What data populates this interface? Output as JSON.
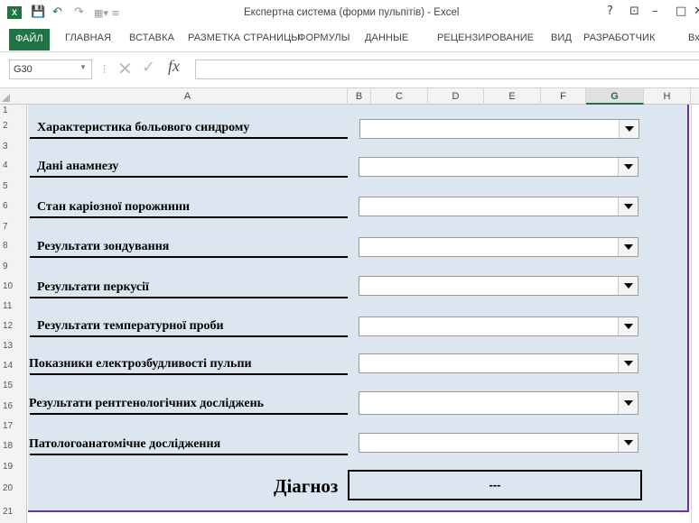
{
  "window": {
    "title": "Експертна система (форми пульпітів) - Excel",
    "help": "?",
    "ribbon_display": "⊡",
    "minimize": "–",
    "close": "✕"
  },
  "ribbon": {
    "tabs": [
      "ФАЙЛ",
      "ГЛАВНАЯ",
      "ВСТАВКА",
      "РАЗМЕТКА СТРАНИЦЫ",
      "ФОРМУЛЫ",
      "ДАННЫЕ",
      "РЕЦЕНЗИРОВАНИЕ",
      "ВИД",
      "РАЗРАБОТЧИК",
      "Вх"
    ]
  },
  "formula_bar": {
    "name_box": "G30",
    "fx": "fx",
    "value": ""
  },
  "columns": [
    "A",
    "B",
    "C",
    "D",
    "E",
    "F",
    "G",
    "H"
  ],
  "active_column": "G",
  "rows": [
    "1",
    "2",
    "3",
    "4",
    "5",
    "6",
    "7",
    "8",
    "9",
    "10",
    "11",
    "12",
    "13",
    "14",
    "15",
    "16",
    "17",
    "18",
    "19",
    "20",
    "21"
  ],
  "form": {
    "fields": [
      {
        "label": "Характеристика больового синдрому",
        "value": ""
      },
      {
        "label": "Дані анамнезу",
        "value": ""
      },
      {
        "label": "Стан каріозної порожнини",
        "value": ""
      },
      {
        "label": "Результати зондування",
        "value": ""
      },
      {
        "label": "Результати перкусії",
        "value": ""
      },
      {
        "label": "Результати температурної проби",
        "value": ""
      },
      {
        "label": "Показники електрозбудливості пульпи",
        "value": ""
      },
      {
        "label": "Результати рентгенологічних досліджень",
        "value": ""
      },
      {
        "label": "Патологоанатомічне дослідження",
        "value": ""
      }
    ],
    "diagnosis_label": "Діагноз",
    "diagnosis_value": "---"
  },
  "colors": {
    "excel_green": "#217346",
    "form_background": "#dce6f1",
    "form_border": "#7030a0"
  },
  "icons": [
    "excel-logo-icon",
    "save-icon",
    "undo-icon",
    "redo-icon",
    "customize-qat-icon",
    "cancel-icon",
    "enter-icon",
    "fx-icon",
    "dropdown-arrow-icon"
  ]
}
